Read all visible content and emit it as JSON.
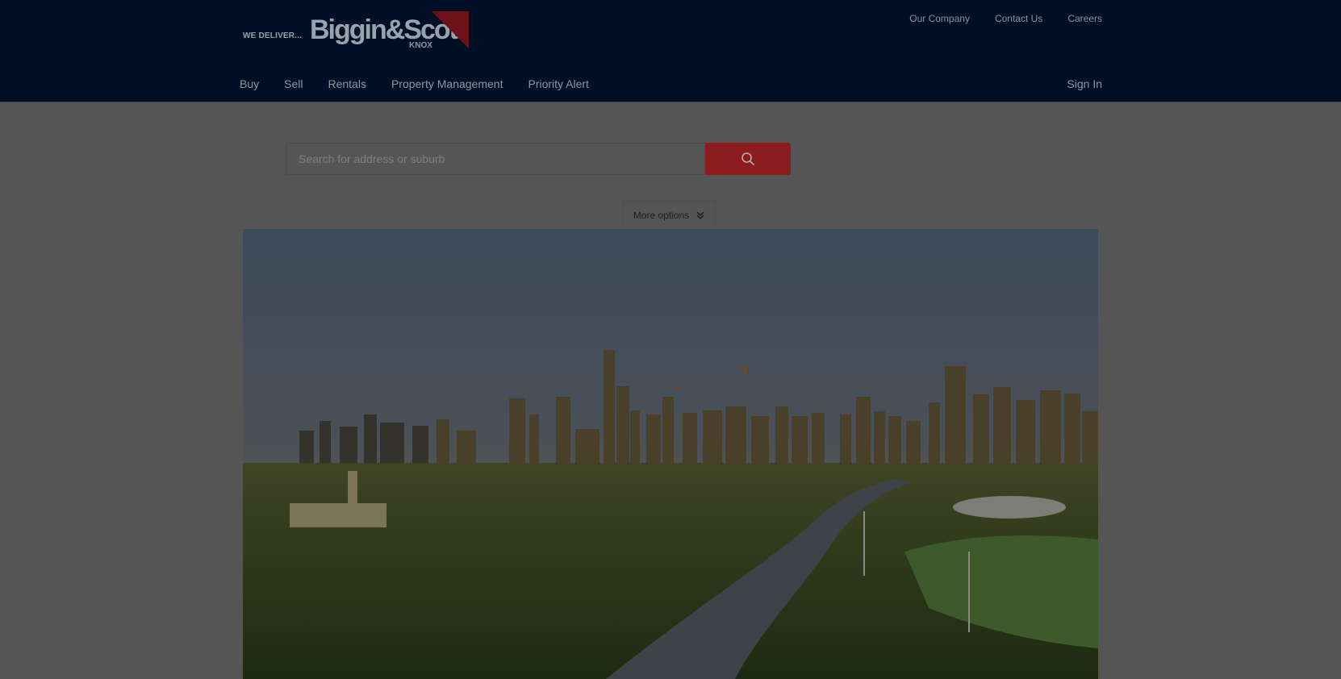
{
  "brand": {
    "tagline": "WE DELIVER...",
    "wordmark": "Biggin&Scott",
    "sub": "KNOX"
  },
  "top_links": [
    {
      "label": "Our Company"
    },
    {
      "label": "Contact Us"
    },
    {
      "label": "Careers"
    }
  ],
  "main_nav": [
    {
      "label": "Buy"
    },
    {
      "label": "Sell"
    },
    {
      "label": "Rentals"
    },
    {
      "label": "Property Management"
    },
    {
      "label": "Priority Alert"
    }
  ],
  "sign_in": "Sign In",
  "search": {
    "placeholder": "Search for address or suburb",
    "value": ""
  },
  "more_options": "More options",
  "colors": {
    "header_bg": "#010f26",
    "accent": "#8a1b1f",
    "overlay_bg": "#555555"
  },
  "icons": {
    "search": "search-icon",
    "more": "double-chevron-down-icon"
  }
}
